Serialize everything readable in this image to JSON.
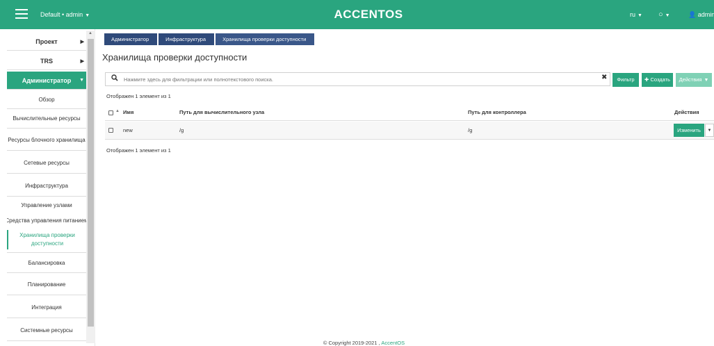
{
  "topbar": {
    "project": "Default • admin",
    "brand": "ACCENTOS",
    "lang": "ru",
    "user": "admin"
  },
  "sidebar": {
    "items": [
      {
        "label": "Проект"
      },
      {
        "label": "TRS"
      },
      {
        "label": "Администратор"
      },
      {
        "label": "Обзор"
      },
      {
        "label": "Вычислительные ресурсы"
      },
      {
        "label": "Ресурсы блочного хранилища"
      },
      {
        "label": "Сетевые ресурсы"
      },
      {
        "label": "Инфраструктура"
      },
      {
        "label": "Управление узлами"
      },
      {
        "label": "Средства управления питанием"
      },
      {
        "label": "Хранилища проверки доступности"
      },
      {
        "label": "Балансировка"
      },
      {
        "label": "Планирование"
      },
      {
        "label": "Интеграция"
      },
      {
        "label": "Системные ресурсы"
      }
    ]
  },
  "breadcrumb": [
    "Администратор",
    "Инфраструктура",
    "Хранилища проверки доступности"
  ],
  "page_title": "Хранилища проверки доступности",
  "search": {
    "placeholder": "Нажмите здесь для фильтрации или полнотекстового поиска."
  },
  "toolbar": {
    "filter": "Фильтр",
    "create": "Создать",
    "actions": "Действия"
  },
  "count_top": "Отображен 1 элемент из 1",
  "count_bottom": "Отображен 1 элемент из 1",
  "table": {
    "headers": {
      "name": "Имя",
      "compute_path": "Путь для вычислительного узла",
      "controller_path": "Путь для контроллера",
      "actions": "Действия"
    },
    "rows": [
      {
        "name": "new",
        "compute_path": "/g",
        "controller_path": "/g",
        "action": "Изменить"
      }
    ]
  },
  "footer": {
    "text": "© Copyright 2019-2021 ,",
    "link": "AccentOS"
  },
  "colors": {
    "accent": "#2aa57f",
    "breadcrumb": "#2f4a7a"
  }
}
